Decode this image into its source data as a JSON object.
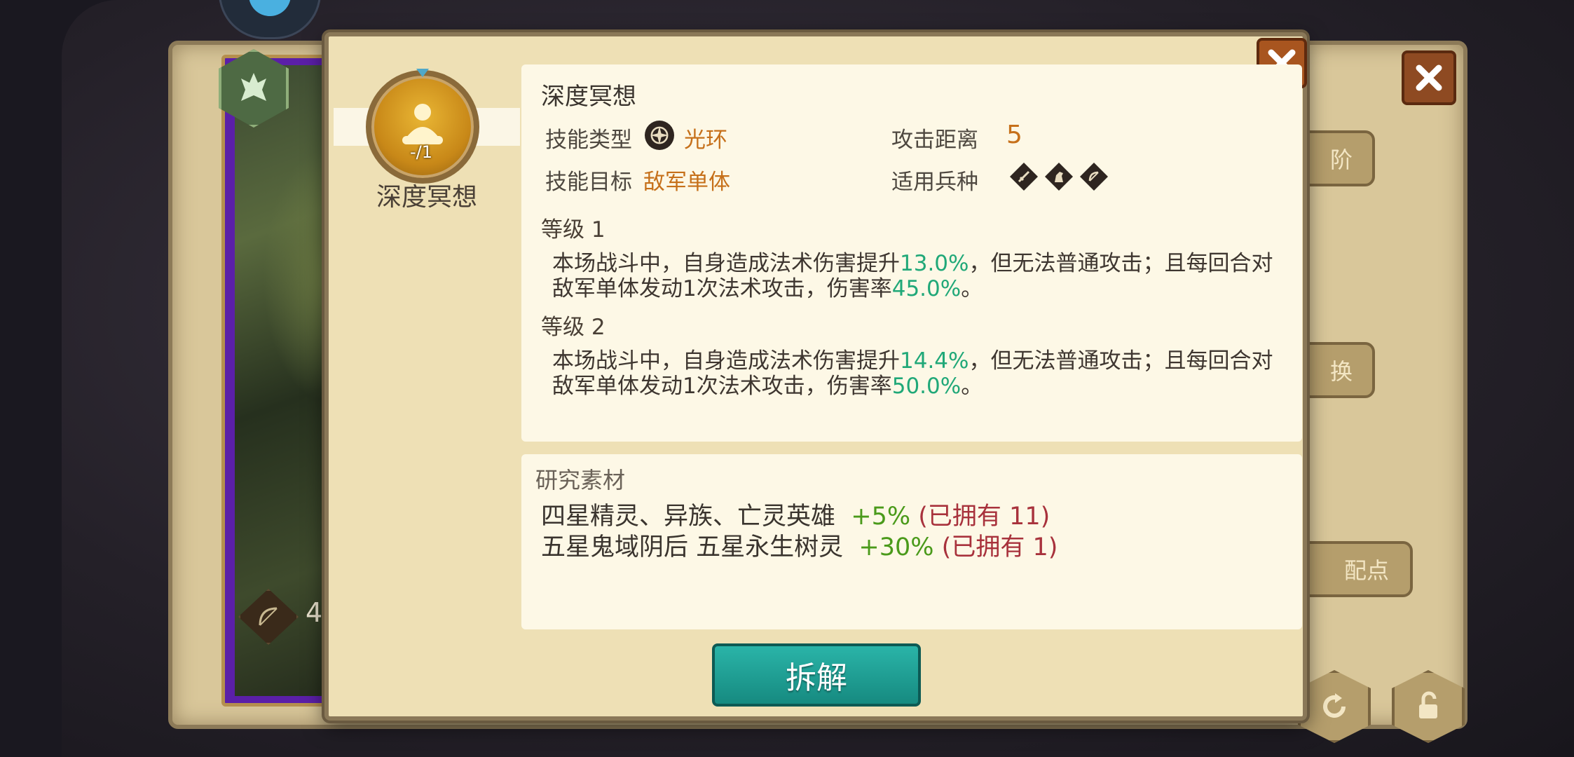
{
  "skill": {
    "name": "深度冥想",
    "level_badge": "-/1",
    "type_label": "技能类型",
    "type_value": "光环",
    "range_label": "攻击距离",
    "range_value": "5",
    "target_label": "技能目标",
    "target_value": "敌军单体",
    "units_label": "适用兵种",
    "unit_icons": [
      "sword-icon",
      "horse-icon",
      "bow-icon"
    ]
  },
  "levels": [
    {
      "heading": "等级 1",
      "text_a": "本场战斗中，自身造成法术伤害提升",
      "pct_a": "13.0%",
      "text_b": "，但无法普通攻击；且每回合对敌军单体发动1次法术攻击，伤害率",
      "pct_b": "45.0%",
      "text_c": "。"
    },
    {
      "heading": "等级 2",
      "text_a": "本场战斗中，自身造成法术伤害提升",
      "pct_a": "14.4%",
      "text_b": "，但无法普通攻击；且每回合对敌军单体发动1次法术攻击，伤害率",
      "pct_b": "50.0%",
      "text_c": "。"
    }
  ],
  "materials": {
    "title": "研究素材",
    "rows": [
      {
        "name": "四星精灵、异族、亡灵英雄",
        "bonus": "+5%",
        "owned": "(已拥有 11)"
      },
      {
        "name": "五星鬼域阴后 五星永生树灵",
        "bonus": "+30%",
        "owned": "(已拥有 1)"
      }
    ]
  },
  "dismantle_label": "拆解",
  "background": {
    "hero_bow_count": "4",
    "side_buttons": [
      "阶",
      "换",
      "配点"
    ]
  },
  "colors": {
    "accent_orange": "#c6701a",
    "percent_green": "#20a878",
    "bonus_green": "#4a9a1a",
    "owned_red": "#a8323c",
    "button_teal": "#1fa094"
  }
}
